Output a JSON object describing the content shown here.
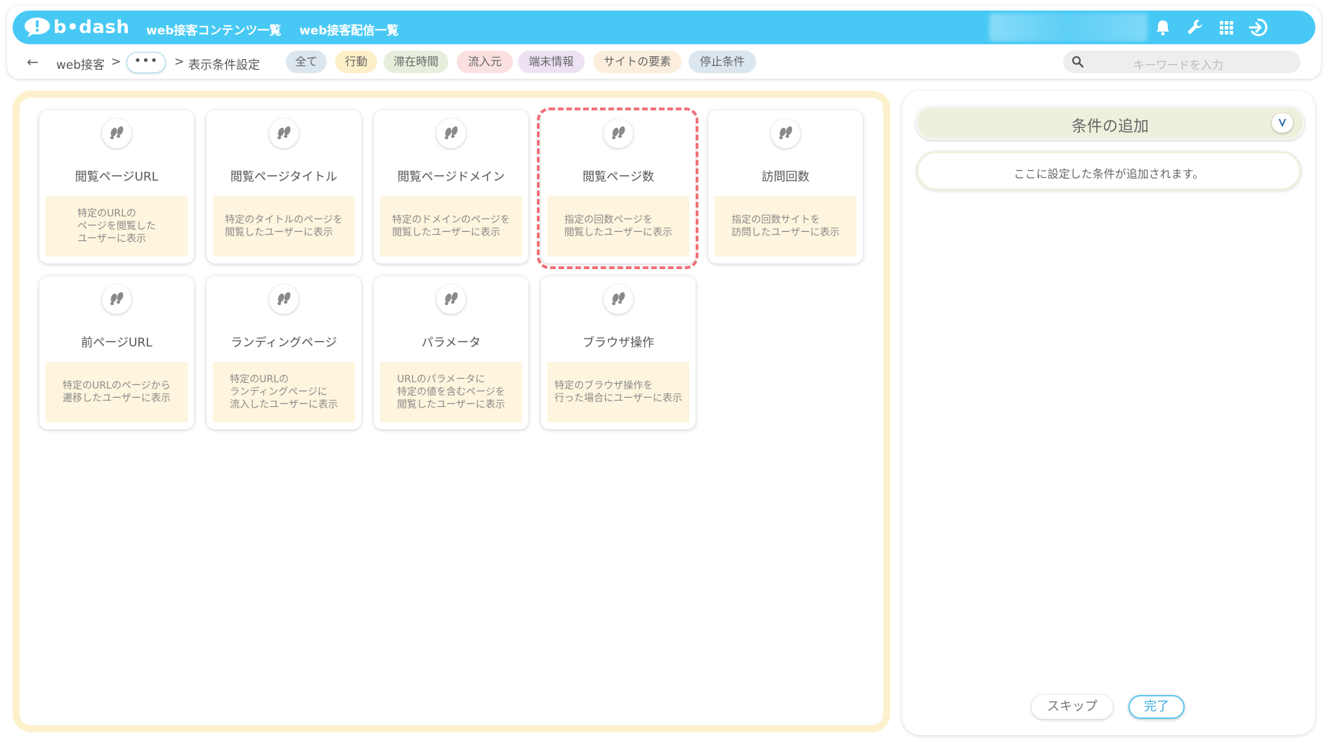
{
  "header": {
    "logo_text": "b•dash",
    "nav": [
      "web接客コンテンツ一覧",
      "web接客配信一覧"
    ]
  },
  "breadcrumb": {
    "root": "web接客",
    "sep1": ">",
    "more": "•••",
    "sep2": ">",
    "current": "表示条件設定"
  },
  "filters": [
    {
      "label": "全て",
      "bg": "#dce6ee"
    },
    {
      "label": "行動",
      "bg": "#fdf0c8"
    },
    {
      "label": "滞在時間",
      "bg": "#e6eedc"
    },
    {
      "label": "流入元",
      "bg": "#fbe0e0"
    },
    {
      "label": "端末情報",
      "bg": "#ede2f3"
    },
    {
      "label": "サイトの要素",
      "bg": "#fbeedd"
    },
    {
      "label": "停止条件",
      "bg": "#dce6ee"
    }
  ],
  "search": {
    "placeholder": "キーワードを入力"
  },
  "cards": [
    {
      "title": "閲覧ページURL",
      "desc": "特定のURLの\nページを閲覧した\nユーザーに表示"
    },
    {
      "title": "閲覧ページタイトル",
      "desc": "特定のタイトルのページを\n閲覧したユーザーに表示"
    },
    {
      "title": "閲覧ページドメイン",
      "desc": "特定のドメインのページを\n閲覧したユーザーに表示"
    },
    {
      "title": "閲覧ページ数",
      "desc": "指定の回数ページを\n閲覧したユーザーに表示"
    },
    {
      "title": "訪問回数",
      "desc": "指定の回数サイトを\n訪問したユーザーに表示"
    },
    {
      "title": "前ページURL",
      "desc": "特定のURLのページから\n遷移したユーザーに表示"
    },
    {
      "title": "ランディングページ",
      "desc": "特定のURLの\nランディングページに\n流入したユーザーに表示"
    },
    {
      "title": "パラメータ",
      "desc": "URLのパラメータに\n特定の値を含むページを\n閲覧したユーザーに表示"
    },
    {
      "title": "ブラウザ操作",
      "desc": "特定のブラウザ操作を\n行った場合にユーザーに表示"
    }
  ],
  "panel": {
    "title": "条件の追加",
    "placeholder": "ここに設定した条件が追加されます。",
    "skip": "スキップ",
    "done": "完了"
  },
  "colors": {
    "brand": "#48c9f5",
    "highlight": "#f07078",
    "panel_border": "#fdf1cd"
  }
}
